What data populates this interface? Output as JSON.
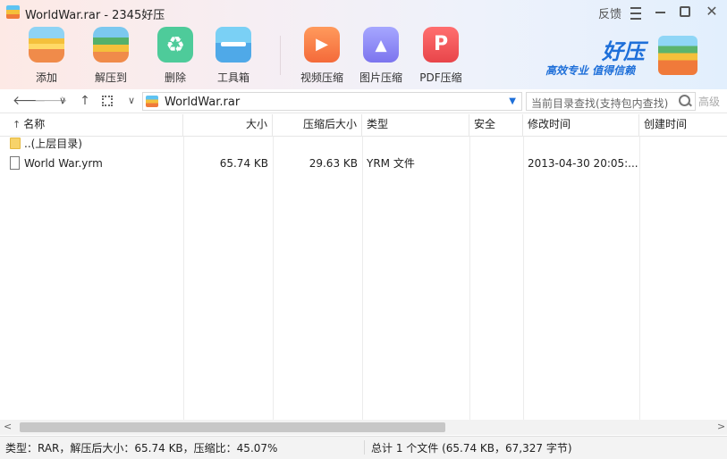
{
  "window": {
    "title": "WorldWar.rar - 2345好压",
    "feedback": "反馈",
    "close_glyph": "✕"
  },
  "toolbar": {
    "items": [
      {
        "label": "添加",
        "icon": "add-archive-icon"
      },
      {
        "label": "解压到",
        "icon": "extract-icon"
      },
      {
        "label": "删除",
        "icon": "delete-icon"
      },
      {
        "label": "工具箱",
        "icon": "toolbox-icon"
      },
      {
        "label": "视频压缩",
        "icon": "video-compress-icon"
      },
      {
        "label": "图片压缩",
        "icon": "image-compress-icon"
      },
      {
        "label": "PDF压缩",
        "icon": "pdf-compress-icon"
      }
    ]
  },
  "brand": {
    "name": "好压",
    "slogan": "高效专业  值得信赖",
    "color": "#1e6fd9"
  },
  "nav": {
    "back": "🡐",
    "forward": "🡒",
    "history_drop": "∨",
    "up": "↑",
    "view_drop": "∨",
    "path": "WorldWar.rar",
    "path_drop": "▼",
    "search_placeholder": "当前目录查找(支持包内查找)",
    "advanced_search": "高级"
  },
  "columns": {
    "sort_arrow": "↑",
    "name": "名称",
    "size": "大小",
    "packed": "压缩后大小",
    "type": "类型",
    "security": "安全",
    "modified": "修改时间",
    "created": "创建时间"
  },
  "rows": [
    {
      "name": "..(上层目录)",
      "size": "",
      "packed": "",
      "type": "",
      "security": "",
      "modified": "",
      "created": "",
      "kind": "folder"
    },
    {
      "name": "World War.yrm",
      "size": "65.74 KB",
      "packed": "29.63 KB",
      "type": "YRM 文件",
      "security": "",
      "modified": "2013-04-30 20:05:...",
      "created": "",
      "kind": "file"
    }
  ],
  "scrollbar": {
    "left": "<",
    "right": ">"
  },
  "status": {
    "left": "类型：RAR，解压后大小：65.74 KB，压缩比：45.07%",
    "right": "总计 1 个文件 (65.74 KB，67,327 字节)"
  }
}
